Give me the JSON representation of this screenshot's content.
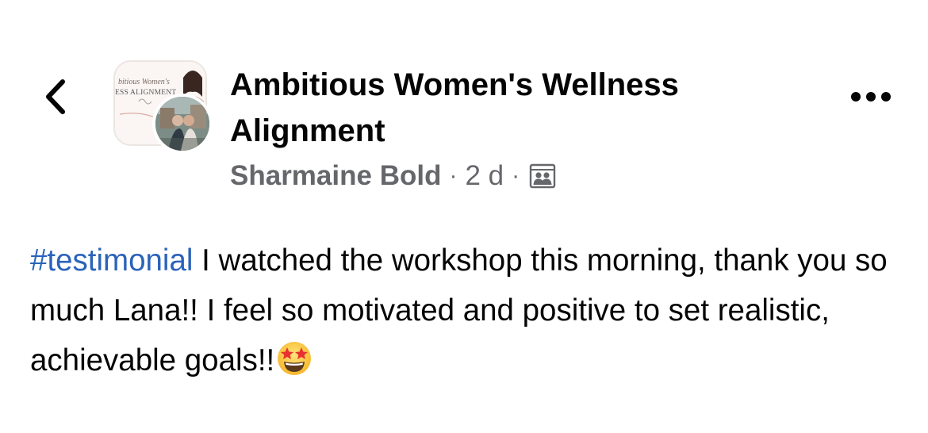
{
  "header": {
    "back_icon": "chevron-left-icon",
    "group_name": "Ambitious Women's Wellness Alignment",
    "group_avatar_lines": [
      "bitious Women's",
      "ESS ALIGNMENT"
    ],
    "more_icon": "more-horizontal-icon"
  },
  "meta": {
    "author": "Sharmaine Bold",
    "separator": "·",
    "time": "2 d",
    "audience_icon": "group-audience-icon"
  },
  "post": {
    "hashtag": "#testimonial",
    "text": " I watched the workshop this morning, thank you so much Lana!! I feel so motivated and positive to set realistic, achievable goals!!",
    "emoji": "star-struck-emoji"
  },
  "colors": {
    "hashtag": "#2a63ba",
    "meta_text": "#65676b",
    "title_text": "#050505"
  }
}
